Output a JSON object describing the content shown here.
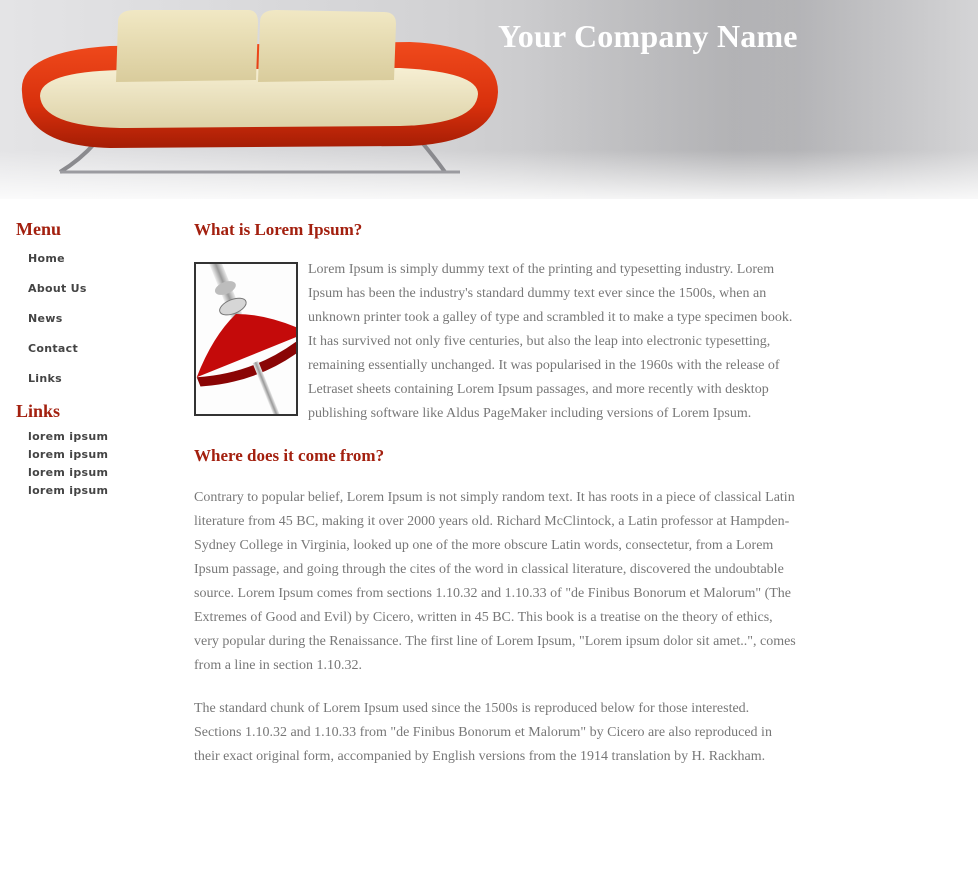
{
  "header": {
    "company_name": "Your Company Name"
  },
  "sidebar": {
    "menu_heading": "Menu",
    "menu_items": [
      {
        "label": "Home"
      },
      {
        "label": "About Us"
      },
      {
        "label": "News"
      },
      {
        "label": "Contact"
      },
      {
        "label": "Links"
      }
    ],
    "links_heading": "Links",
    "links": [
      {
        "label": "lorem ipsum"
      },
      {
        "label": "lorem ipsum"
      },
      {
        "label": "lorem ipsum"
      },
      {
        "label": "lorem ipsum"
      }
    ]
  },
  "main": {
    "section1": {
      "title": "What is Lorem Ipsum?",
      "body": "Lorem Ipsum is simply dummy text of the printing and typesetting industry. Lorem Ipsum has been the industry's standard dummy text ever since the 1500s, when an unknown printer took a galley of type and scrambled it to make a type specimen book. It has survived not only five centuries, but also the leap into electronic typesetting, remaining essentially unchanged. It was popularised in the 1960s with the release of Letraset sheets containing Lorem Ipsum passages, and more recently with desktop publishing software like Aldus PageMaker including versions of Lorem Ipsum."
    },
    "section2": {
      "title": "Where does it come from?",
      "paragraph1": "Contrary to popular belief, Lorem Ipsum is not simply random text. It has roots in a piece of classical Latin literature from 45 BC, making it over 2000 years old. Richard McClintock, a Latin professor at Hampden-Sydney College in Virginia, looked up one of the more obscure Latin words, consectetur, from a Lorem Ipsum passage, and going through the cites of the word in classical literature, discovered the undoubtable source. Lorem Ipsum comes from sections 1.10.32 and 1.10.33 of \"de Finibus Bonorum et Malorum\" (The Extremes of Good and Evil) by Cicero, written in 45 BC. This book is a treatise on the theory of ethics, very popular during the Renaissance. The first line of Lorem Ipsum, \"Lorem ipsum dolor sit amet..\", comes from a line in section 1.10.32.",
      "paragraph2": "The standard chunk of Lorem Ipsum used since the 1500s is reproduced below for those interested. Sections 1.10.32 and 1.10.33 from \"de Finibus Bonorum et Malorum\" by Cicero are also reproduced in their exact original form, accompanied by English versions from the 1914 translation by H. Rackham."
    }
  },
  "colors": {
    "accent": "#a3200f",
    "body_text": "#777777",
    "nav_text": "#444444",
    "sofa_frame": "#e0350f",
    "cushion": "#efe6c2"
  }
}
